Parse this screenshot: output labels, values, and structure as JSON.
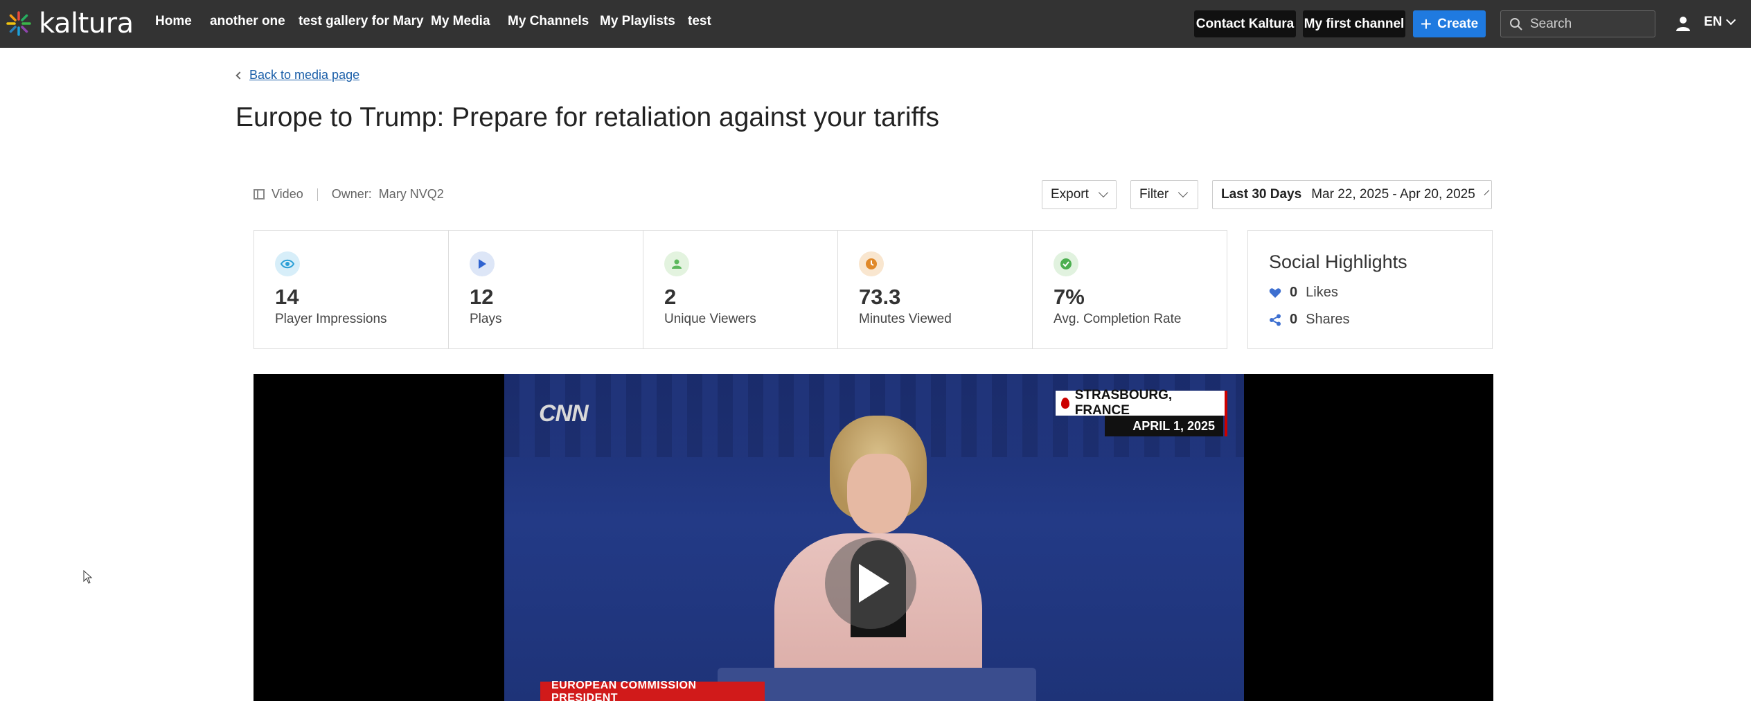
{
  "brand": {
    "name": "kaltura"
  },
  "nav": {
    "items": [
      {
        "label": "Home"
      },
      {
        "label": "another one"
      },
      {
        "label": "test gallery for Mary"
      },
      {
        "label": "My Media"
      },
      {
        "label": "My Channels"
      },
      {
        "label": "My Playlists"
      },
      {
        "label": "test"
      }
    ],
    "contact_label": "Contact Kaltura",
    "channel_label": "My first channel",
    "create_label": "Create",
    "search_placeholder": "Search",
    "language": "EN"
  },
  "page": {
    "back_link": "Back to media page",
    "title": "Europe to Trump: Prepare for retaliation against your tariffs",
    "media_type": "Video",
    "owner_label": "Owner:",
    "owner_name": "Mary NVQ2"
  },
  "controls": {
    "export_label": "Export",
    "filter_label": "Filter",
    "range_label": "Last 30 Days",
    "range_dates": "Mar 22, 2025 - Apr 20, 2025"
  },
  "stats": [
    {
      "value": "14",
      "label": "Player Impressions",
      "icon": "eye-icon",
      "color": "#2a9fd6"
    },
    {
      "value": "12",
      "label": "Plays",
      "icon": "play-icon",
      "color": "#2f63d0"
    },
    {
      "value": "2",
      "label": "Unique Viewers",
      "icon": "user-icon",
      "color": "#5cb85c"
    },
    {
      "value": "73.3",
      "label": "Minutes Viewed",
      "icon": "clock-icon",
      "color": "#e0892a"
    },
    {
      "value": "7%",
      "label": "Avg. Completion Rate",
      "icon": "check-icon",
      "color": "#4caf50"
    }
  ],
  "social": {
    "title": "Social Highlights",
    "likes_count": "0",
    "likes_label": "Likes",
    "shares_count": "0",
    "shares_label": "Shares"
  },
  "video": {
    "channel_logo": "CNN",
    "location": "STRASBOURG, FRANCE",
    "date": "APRIL 1, 2025",
    "lower_third": "EUROPEAN COMMISSION PRESIDENT"
  },
  "colors": {
    "topbar": "#333333",
    "accent": "#1f7ae0",
    "link": "#1a5ea8"
  }
}
